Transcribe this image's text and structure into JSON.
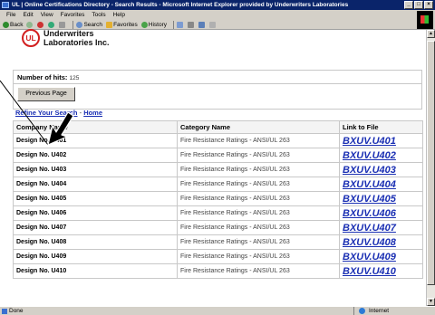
{
  "window": {
    "title": "UL | Online Certifications Directory - Search Results - Microsoft Internet Explorer provided by Underwriters Laboratories",
    "buttons": [
      "_",
      "□",
      "×"
    ]
  },
  "menu": [
    "File",
    "Edit",
    "View",
    "Favorites",
    "Tools",
    "Help"
  ],
  "toolbar": {
    "back": "Back",
    "search": "Search",
    "favorites": "Favorites",
    "history": "History"
  },
  "logo": {
    "badge": "UL",
    "line1": "Underwriters",
    "line2": "Laboratories Inc."
  },
  "hits": {
    "label": "Number of hits:",
    "count": "125"
  },
  "previous_button": "Previous Page",
  "links": {
    "refine": "Refine Your Search",
    "separator": "-",
    "home": "Home"
  },
  "table": {
    "headers": [
      "Company Name",
      "Category Name",
      "Link to File"
    ],
    "rows": [
      {
        "company": "Design No. U401",
        "category": "Fire Resistance Ratings - ANSI/UL 263",
        "file": "BXUV.U401"
      },
      {
        "company": "Design No. U402",
        "category": "Fire Resistance Ratings - ANSI/UL 263",
        "file": "BXUV.U402"
      },
      {
        "company": "Design No. U403",
        "category": "Fire Resistance Ratings - ANSI/UL 263",
        "file": "BXUV.U403"
      },
      {
        "company": "Design No. U404",
        "category": "Fire Resistance Ratings - ANSI/UL 263",
        "file": "BXUV.U404"
      },
      {
        "company": "Design No. U405",
        "category": "Fire Resistance Ratings - ANSI/UL 263",
        "file": "BXUV.U405"
      },
      {
        "company": "Design No. U406",
        "category": "Fire Resistance Ratings - ANSI/UL 263",
        "file": "BXUV.U406"
      },
      {
        "company": "Design No. U407",
        "category": "Fire Resistance Ratings - ANSI/UL 263",
        "file": "BXUV.U407"
      },
      {
        "company": "Design No. U408",
        "category": "Fire Resistance Ratings - ANSI/UL 263",
        "file": "BXUV.U408"
      },
      {
        "company": "Design No. U409",
        "category": "Fire Resistance Ratings - ANSI/UL 263",
        "file": "BXUV.U409"
      },
      {
        "company": "Design No. U410",
        "category": "Fire Resistance Ratings - ANSI/UL 263",
        "file": "BXUV.U410"
      }
    ]
  },
  "status": {
    "left": "Done",
    "right": "Internet"
  },
  "colors": {
    "titlebar": "#0a246a",
    "link": "#1a2fb3",
    "ul_red": "#d21f1f"
  }
}
